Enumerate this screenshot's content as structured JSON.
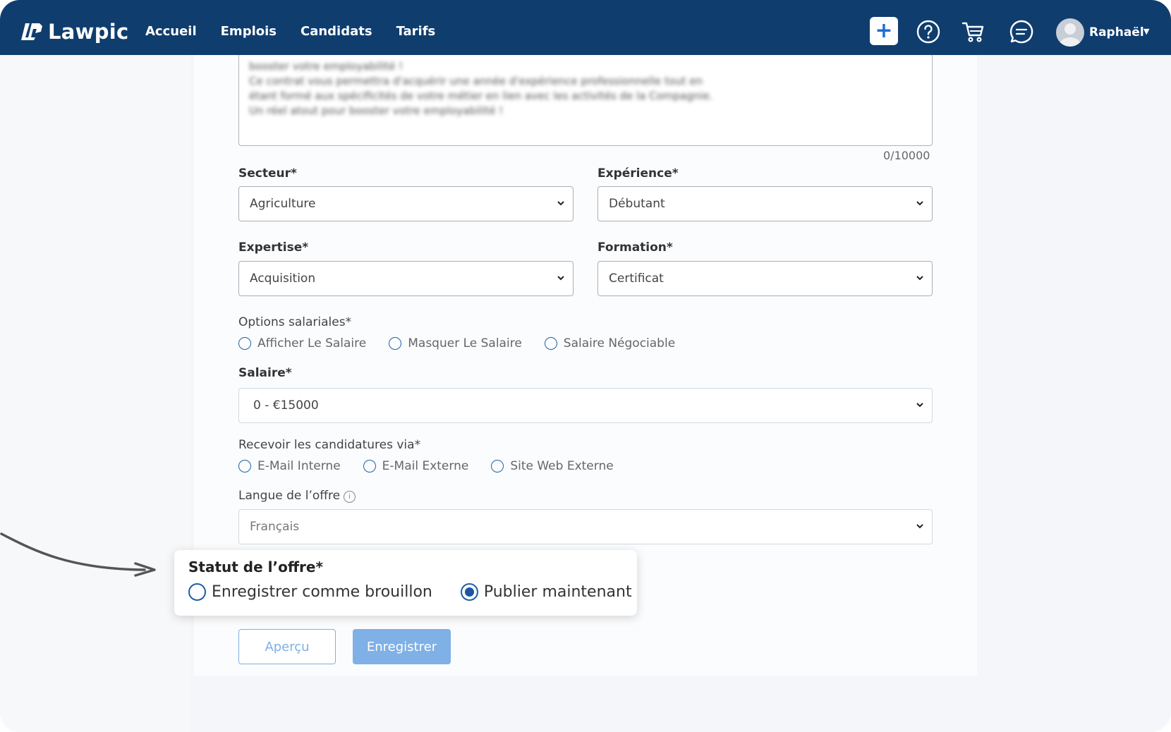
{
  "app": {
    "logo_text": "Lawpic"
  },
  "nav": {
    "links": [
      "Accueil",
      "Emplois",
      "Candidats",
      "Tarifs"
    ],
    "plus_symbol": "+",
    "user_name": "Raphaël"
  },
  "description": {
    "lines": [
      "booster votre employabilité !",
      "Ce contrat vous permettra d'acquérir une année d'expérience professionnelle tout en",
      "étant formé aux spécificités de votre métier en lien avec les activités de la Compagnie.",
      "Un réel atout pour booster votre employabilité !"
    ],
    "counter": "0/10000"
  },
  "form": {
    "secteur": {
      "label": "Secteur*",
      "value": "Agriculture"
    },
    "experience": {
      "label": "Expérience*",
      "value": "Débutant"
    },
    "expertise": {
      "label": "Expertise*",
      "value": "Acquisition"
    },
    "formation": {
      "label": "Formation*",
      "value": "Certificat"
    },
    "salary_options": {
      "label": "Options salariales*",
      "options": [
        "Afficher Le Salaire",
        "Masquer Le Salaire",
        "Salaire Négociable"
      ]
    },
    "salaire": {
      "label": "Salaire*",
      "value": "0 - €15000"
    },
    "receive_via": {
      "label": "Recevoir les candidatures via*",
      "options": [
        "E-Mail Interne",
        "E-Mail Externe",
        "Site Web Externe"
      ]
    },
    "langue": {
      "label": "Langue de l’offre",
      "value": "Français",
      "info_symbol": "i"
    }
  },
  "status": {
    "label": "Statut de l’offre*",
    "options": [
      "Enregistrer comme brouillon",
      "Publier maintenant"
    ],
    "selected": "Publier maintenant"
  },
  "buttons": {
    "preview": "Aperçu",
    "save": "Enregistrer"
  },
  "colors": {
    "navbar": "#0f3d6e",
    "accent": "#1f5fa8",
    "button_light": "#7fb0e6"
  }
}
